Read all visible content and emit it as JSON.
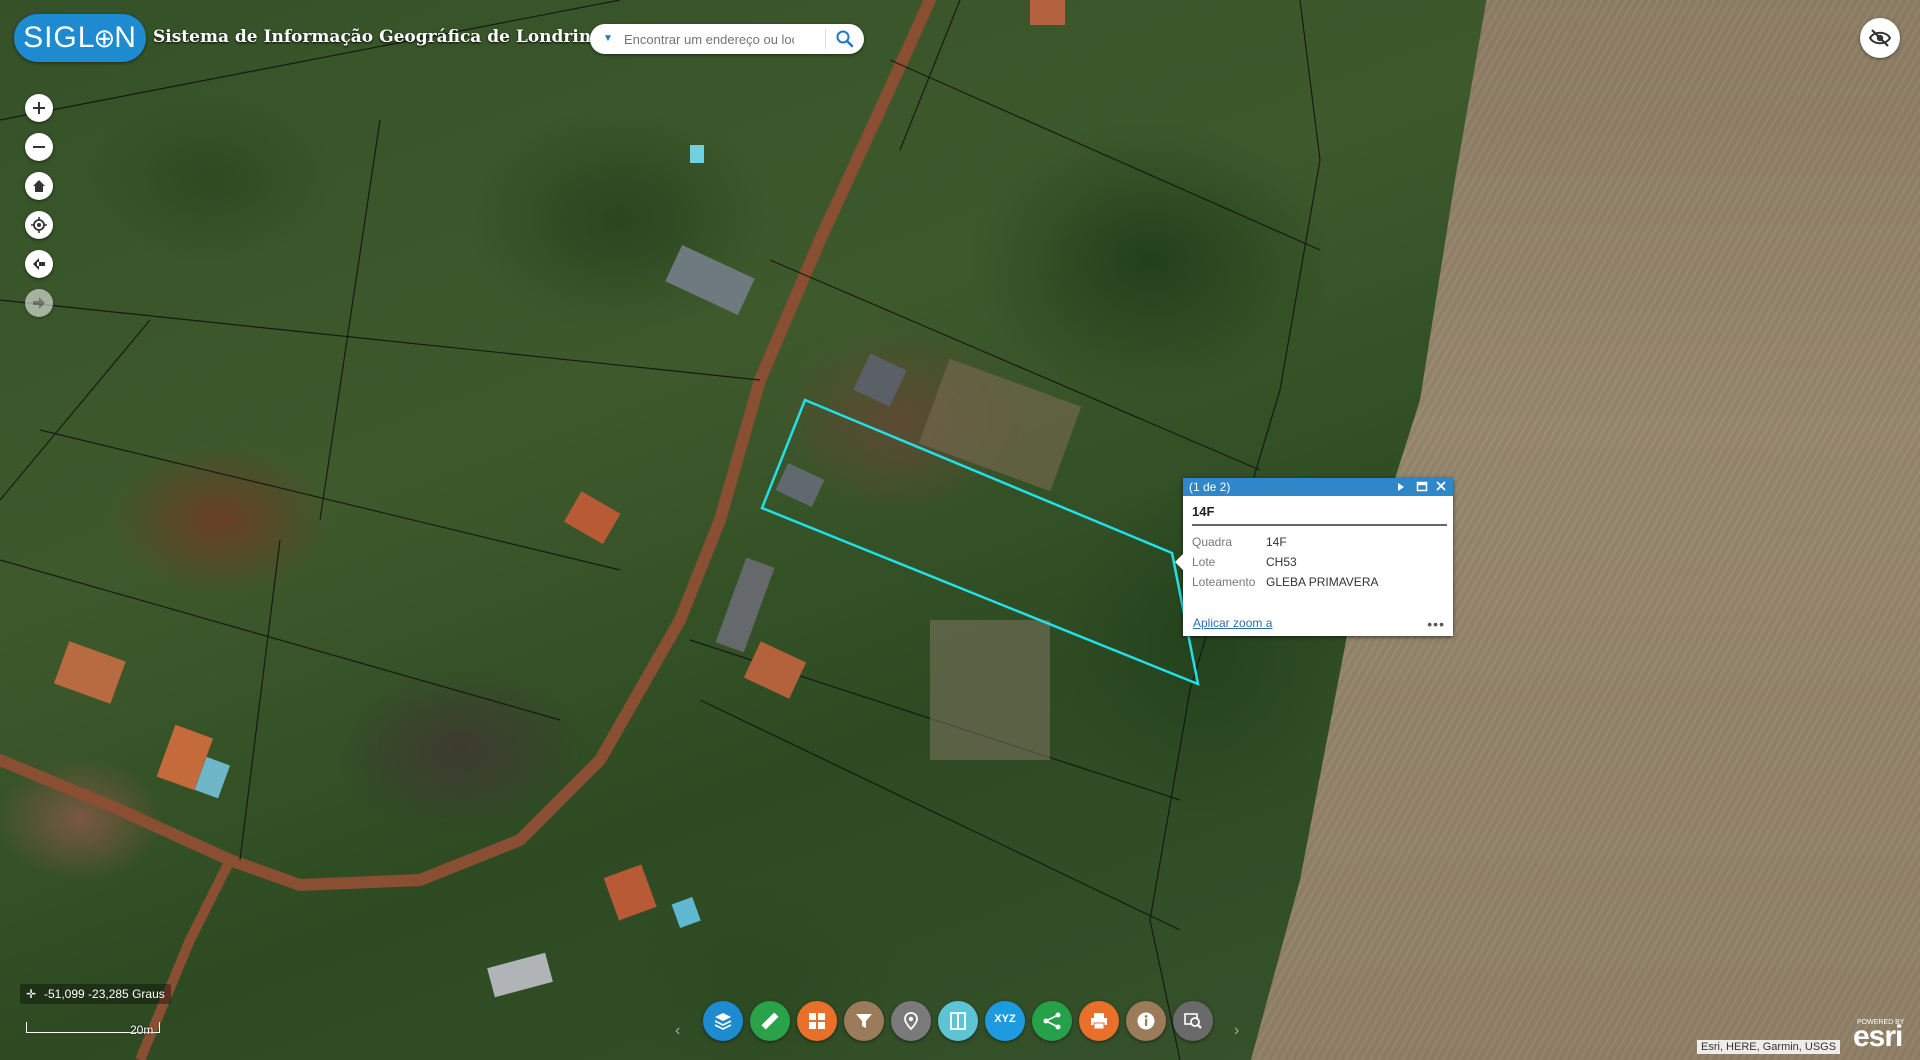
{
  "header": {
    "logo_text_left": "SIGL",
    "logo_text_right": "N",
    "title": "Sistema de Informação Geográfica de Londrina",
    "search_placeholder": "Encontrar um endereço ou loc"
  },
  "popup": {
    "counter": "(1 de 2)",
    "title": "14F",
    "fields": [
      {
        "label": "Quadra",
        "value": "14F"
      },
      {
        "label": "Lote",
        "value": "CH53"
      },
      {
        "label": "Loteamento",
        "value": "GLEBA PRIMAVERA"
      }
    ],
    "zoom_link": "Aplicar zoom a",
    "more": "•••"
  },
  "status": {
    "coordinates": "-51,099 -23,285 Graus",
    "scale_label": "20m"
  },
  "toolbar": {
    "xyz_label": "XYZ",
    "prev": "‹",
    "next": "›",
    "colors": {
      "layers": "#1e8ad0",
      "measure": "#2aa24a",
      "basemap": "#e8702a",
      "filter": "#9b7b5a",
      "location": "#7a7a7a",
      "swipe": "#5cc4d4",
      "xyz": "#1e9be0",
      "share": "#27a04a",
      "print": "#e8702a",
      "about": "#9b7b5a",
      "search": "#6a6a6a"
    }
  },
  "attribution": "Esri, HERE, Garmin, USGS",
  "esri": {
    "powered_by": "POWERED BY",
    "logo": "esri"
  }
}
